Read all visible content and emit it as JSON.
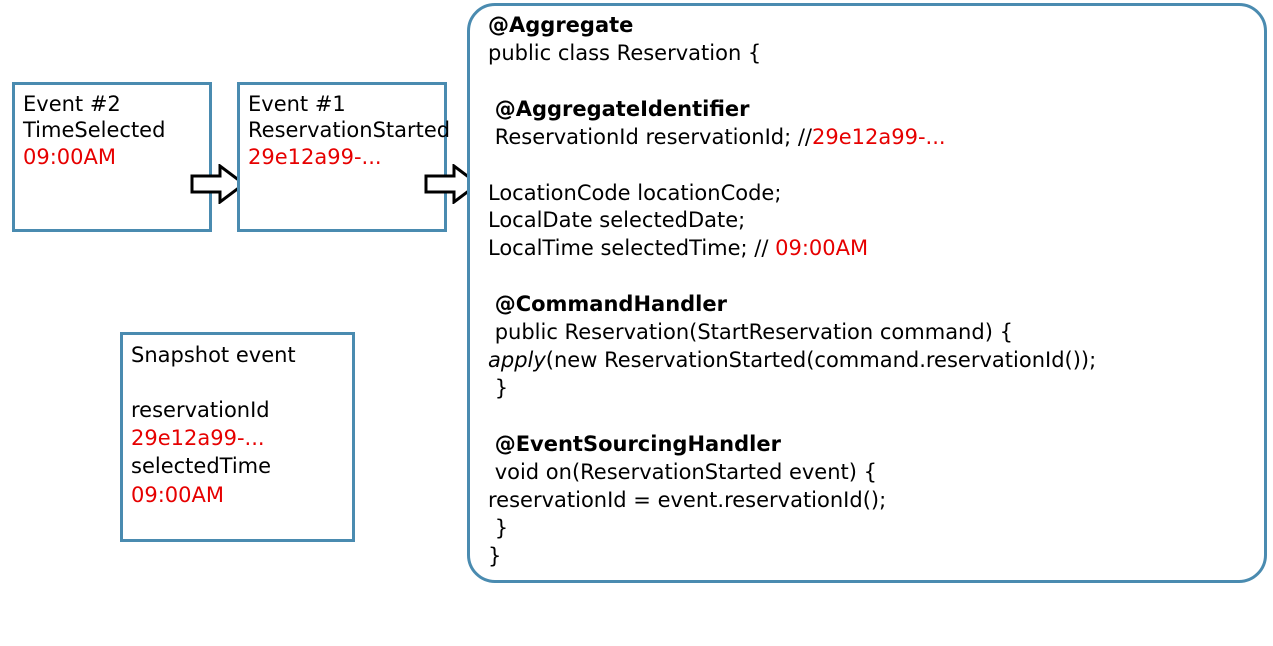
{
  "event2": {
    "title": "Event #2",
    "name": "TimeSelected",
    "value": "09:00AM"
  },
  "event1": {
    "title": "Event #1",
    "name": "ReservationStarted",
    "value": "29e12a99-..."
  },
  "snapshot": {
    "title": "Snapshot event",
    "field1": "reservationId",
    "value1": "29e12a99-...",
    "field2": "selectedTime",
    "value2": "09:00AM"
  },
  "code": {
    "l1": "@Aggregate",
    "l2": "public class Reservation {",
    "l3": "@AggregateIdentifier",
    "l4a": "ReservationId reservationId; //",
    "l4b": "29e12a99-...",
    "l5": " LocationCode locationCode;",
    "l6": " LocalDate selectedDate;",
    "l7a": " LocalTime selectedTime; // ",
    "l7b": "09:00AM",
    "l8": "@CommandHandler",
    "l9": "public Reservation(StartReservation command) {",
    "l10a": "   ",
    "l10b": "apply",
    "l10c": "(new ReservationStarted(command.reservationId());",
    "l11": "}",
    "l12": "@EventSourcingHandler",
    "l13": "void on(ReservationStarted event) {",
    "l14": "    reservationId = event.reservationId();",
    "l15": "}",
    "l16": "}"
  }
}
